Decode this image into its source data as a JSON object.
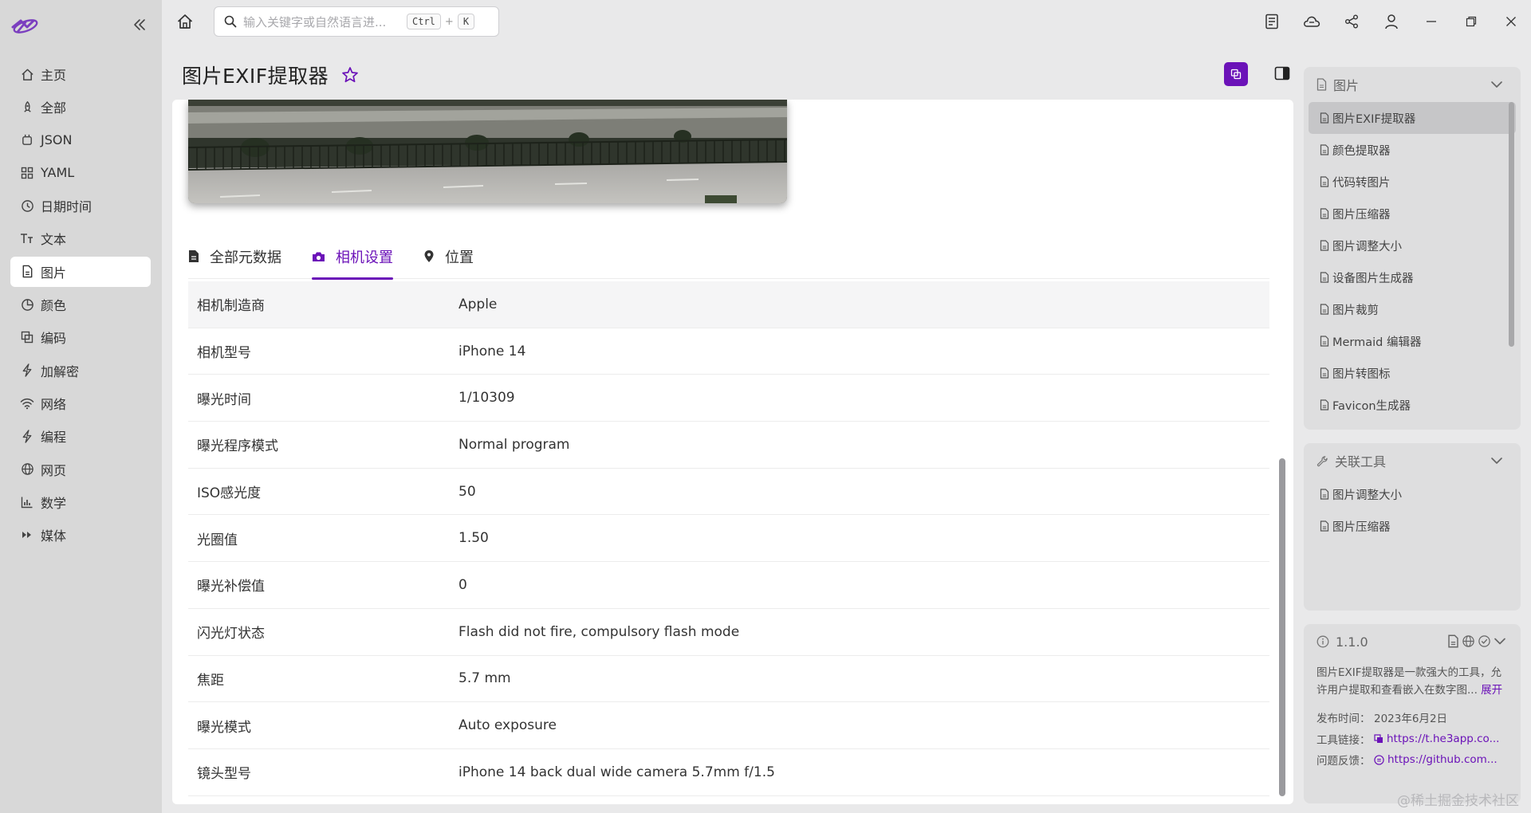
{
  "app": {
    "search_placeholder": "输入关键字或自然语言进...",
    "shortcut_ctrl": "Ctrl",
    "shortcut_plus": "+",
    "shortcut_k": "K",
    "accent_color": "#6b12b8"
  },
  "sidebar": {
    "items": [
      {
        "label": "主页",
        "icon": "home-icon"
      },
      {
        "label": "全部",
        "icon": "rocket-icon"
      },
      {
        "label": "JSON",
        "icon": "braces-icon"
      },
      {
        "label": "YAML",
        "icon": "grid-icon"
      },
      {
        "label": "日期时间",
        "icon": "clock-icon"
      },
      {
        "label": "文本",
        "icon": "text-icon"
      },
      {
        "label": "图片",
        "icon": "image-file-icon"
      },
      {
        "label": "颜色",
        "icon": "palette-icon"
      },
      {
        "label": "编码",
        "icon": "copy-icon"
      },
      {
        "label": "加解密",
        "icon": "bolt-icon"
      },
      {
        "label": "网络",
        "icon": "wifi-icon"
      },
      {
        "label": "编程",
        "icon": "bolt-icon"
      },
      {
        "label": "网页",
        "icon": "globe-icon"
      },
      {
        "label": "数学",
        "icon": "bar-chart-icon"
      },
      {
        "label": "媒体",
        "icon": "fast-forward-icon"
      }
    ],
    "active_label": "图片"
  },
  "main": {
    "title": "图片EXIF提取器",
    "tabs": [
      {
        "label": "全部元数据",
        "icon": "document-icon"
      },
      {
        "label": "相机设置",
        "icon": "camera-icon"
      },
      {
        "label": "位置",
        "icon": "location-pin-icon"
      }
    ],
    "active_tab": "相机设置",
    "rows": [
      {
        "key": "相机制造商",
        "value": "Apple"
      },
      {
        "key": "相机型号",
        "value": "iPhone 14"
      },
      {
        "key": "曝光时间",
        "value": "1/10309"
      },
      {
        "key": "曝光程序模式",
        "value": "Normal program"
      },
      {
        "key": "ISO感光度",
        "value": "50"
      },
      {
        "key": "光圈值",
        "value": "1.50"
      },
      {
        "key": "曝光补偿值",
        "value": "0"
      },
      {
        "key": "闪光灯状态",
        "value": "Flash did not fire, compulsory flash mode"
      },
      {
        "key": "焦距",
        "value": "5.7 mm"
      },
      {
        "key": "曝光模式",
        "value": "Auto exposure"
      },
      {
        "key": "镜头型号",
        "value": "iPhone 14 back dual wide camera 5.7mm f/1.5"
      }
    ]
  },
  "right_panel": {
    "category": {
      "title": "图片",
      "items": [
        "图片EXIF提取器",
        "颜色提取器",
        "代码转图片",
        "图片压缩器",
        "图片调整大小",
        "设备图片生成器",
        "图片裁剪",
        "Mermaid 编辑器",
        "图片转图标",
        "Favicon生成器"
      ],
      "active": "图片EXIF提取器"
    },
    "related": {
      "title": "关联工具",
      "items": [
        "图片调整大小",
        "图片压缩器"
      ]
    },
    "info": {
      "version": "1.1.0",
      "description": "图片EXIF提取器是一款强大的工具，允许用户提取和查看嵌入在数字图...",
      "expand_label": "展开",
      "publish_label": "发布时间：",
      "publish_date": "2023年6月2日",
      "link_label": "工具链接：",
      "link_value": "https://t.he3app.co...",
      "feedback_label": "问题反馈：",
      "feedback_value": "https://github.com..."
    }
  },
  "watermark": "@稀土掘金技术社区"
}
